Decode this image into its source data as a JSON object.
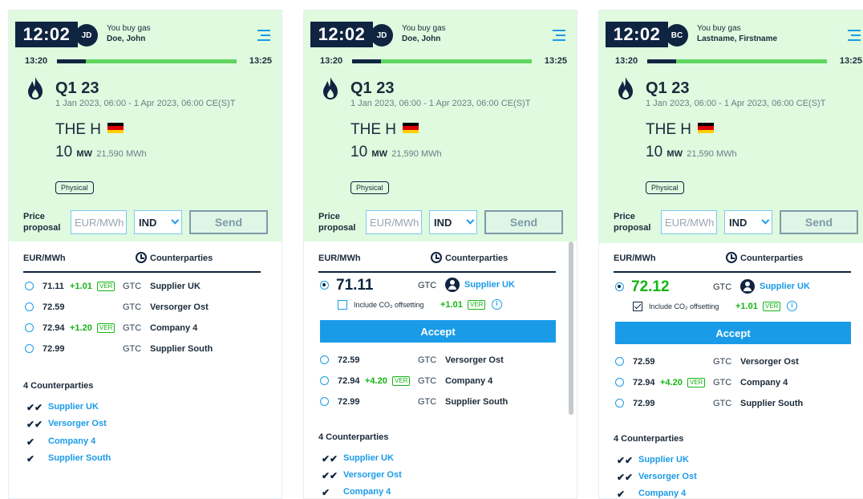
{
  "panels": [
    {
      "time": "12:02",
      "initials": "JD",
      "action": "You buy gas",
      "user": "Doe, John",
      "start": "13:20",
      "end": "13:25",
      "progress": 0.16,
      "product": "Q1 23",
      "period": "1 Jan 2023, 06:00 - 1 Apr 2023, 06:00 CE(S)T",
      "hub": "THE H",
      "qty": "10",
      "unit": "MW",
      "mwh": "21,590 MWh",
      "tag": "Physical",
      "price_label_1": "Price",
      "price_label_2": "proposal",
      "placeholder": "EUR/MWh",
      "select": "IND",
      "send": "Send",
      "col1": "EUR/MWh",
      "col3": "Counterparties",
      "rows": [
        {
          "price": "71.11",
          "delta": "+1.01",
          "ver": "VER",
          "gtc": "GTC",
          "cp": "Supplier UK"
        },
        {
          "price": "72.59",
          "gtc": "GTC",
          "cp": "Versorger Ost"
        },
        {
          "price": "72.94",
          "delta": "+1.20",
          "ver": "VER",
          "gtc": "GTC",
          "cp": "Company 4"
        },
        {
          "price": "72.99",
          "gtc": "GTC",
          "cp": "Supplier South"
        }
      ],
      "cp_heading": "4 Counterparties",
      "cps": [
        {
          "chk": "✔✔",
          "name": "Supplier UK"
        },
        {
          "chk": "✔✔",
          "name": "Versorger Ost"
        },
        {
          "chk": "✔",
          "name": "Company 4"
        },
        {
          "chk": "✔",
          "name": "Supplier South"
        }
      ]
    },
    {
      "time": "12:02",
      "initials": "JD",
      "action": "You buy gas",
      "user": "Doe, John",
      "start": "13:20",
      "end": "13:25",
      "progress": 0.16,
      "product": "Q1 23",
      "period": "1 Jan 2023, 06:00 - 1 Apr 2023, 06:00 CE(S)T",
      "hub": "THE H",
      "qty": "10",
      "unit": "MW",
      "mwh": "21,590 MWh",
      "tag": "Physical",
      "price_label_1": "Price",
      "price_label_2": "proposal",
      "placeholder": "EUR/MWh",
      "select": "IND",
      "send": "Send",
      "col1": "EUR/MWh",
      "col3": "Counterparties",
      "selected": {
        "price": "71.11",
        "gtc": "GTC",
        "cp": "Supplier UK"
      },
      "co2": {
        "label": "Include CO₂ offsetting",
        "delta": "+1.01",
        "ver": "VER",
        "info": "i",
        "checked": false
      },
      "accept": "Accept",
      "rows": [
        {
          "price": "72.59",
          "gtc": "GTC",
          "cp": "Versorger Ost"
        },
        {
          "price": "72.94",
          "delta": "+4.20",
          "ver": "VER",
          "gtc": "GTC",
          "cp": "Company 4"
        },
        {
          "price": "72.99",
          "gtc": "GTC",
          "cp": "Supplier South"
        }
      ],
      "cp_heading": "4 Counterparties",
      "cps": [
        {
          "chk": "✔✔",
          "name": "Supplier UK"
        },
        {
          "chk": "✔✔",
          "name": "Versorger Ost"
        },
        {
          "chk": "✔",
          "name": "Company 4"
        }
      ]
    },
    {
      "time": "12:02",
      "initials": "BC",
      "action": "You buy gas",
      "user": "Lastname, Firstname",
      "start": "13:20",
      "end": "13:25",
      "progress": 0.16,
      "product": "Q1 23",
      "period": "1 Jan 2023, 06:00 - 1 Apr 2023, 06:00 CE(S)T",
      "hub": "THE H",
      "qty": "10",
      "unit": "MW",
      "mwh": "21,590 MWh",
      "tag": "Physical",
      "price_label_1": "Price",
      "price_label_2": "proposal",
      "placeholder": "EUR/MWh",
      "select": "IND",
      "send": "Send",
      "col1": "EUR/MWh",
      "col3": "Counterparties",
      "selected": {
        "price": "72.12",
        "gtc": "GTC",
        "cp": "Supplier UK"
      },
      "co2": {
        "label": "Include CO₂ offsetting",
        "delta": "+1.01",
        "ver": "VER",
        "info": "i",
        "checked": true
      },
      "accept": "Accept",
      "rows": [
        {
          "price": "72.59",
          "gtc": "GTC",
          "cp": "Versorger Ost"
        },
        {
          "price": "72.94",
          "delta": "+4.20",
          "ver": "VER",
          "gtc": "GTC",
          "cp": "Company 4"
        },
        {
          "price": "72.99",
          "gtc": "GTC",
          "cp": "Supplier South"
        }
      ],
      "cp_heading": "4 Counterparties",
      "cps": [
        {
          "chk": "✔✔",
          "name": "Supplier UK"
        },
        {
          "chk": "✔✔",
          "name": "Versorger Ost"
        },
        {
          "chk": "✔",
          "name": "Company 4"
        }
      ]
    }
  ],
  "colors": {
    "header_bg": "#dffadf",
    "navy": "#0e2440",
    "accent": "#1a9be8",
    "green": "#14b514"
  }
}
